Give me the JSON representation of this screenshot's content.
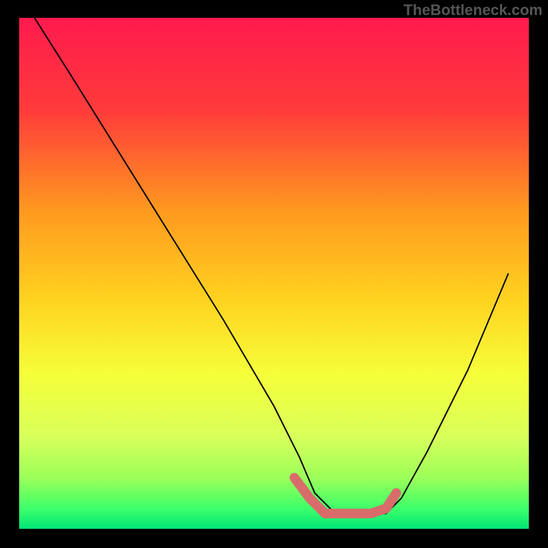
{
  "watermark": "TheBottleneck.com",
  "chart_data": {
    "type": "line",
    "title": "",
    "xlabel": "",
    "ylabel": "",
    "xlim": [
      0,
      100
    ],
    "ylim": [
      0,
      100
    ],
    "gradient_stops": [
      {
        "offset": 0,
        "color": "#ff1a4d"
      },
      {
        "offset": 18,
        "color": "#ff3b3b"
      },
      {
        "offset": 38,
        "color": "#ff9a1f"
      },
      {
        "offset": 55,
        "color": "#ffd21f"
      },
      {
        "offset": 70,
        "color": "#f5ff3a"
      },
      {
        "offset": 82,
        "color": "#d8ff5a"
      },
      {
        "offset": 90,
        "color": "#9cff5a"
      },
      {
        "offset": 96,
        "color": "#3eff6a"
      },
      {
        "offset": 100,
        "color": "#00e676"
      }
    ],
    "series": [
      {
        "name": "bottleneck-curve",
        "x": [
          3,
          10,
          20,
          30,
          40,
          50,
          55,
          58,
          62,
          68,
          72,
          75,
          80,
          88,
          96
        ],
        "values": [
          100,
          89,
          73,
          57,
          41,
          24,
          14,
          7,
          3,
          3,
          3,
          6,
          15,
          31,
          50
        ]
      }
    ],
    "highlight": {
      "name": "optimal-range",
      "color": "#d96b6b",
      "x": [
        54,
        57,
        60,
        63,
        66,
        69,
        72,
        74
      ],
      "values": [
        10,
        6,
        3,
        3,
        3,
        3,
        4,
        7
      ]
    }
  }
}
